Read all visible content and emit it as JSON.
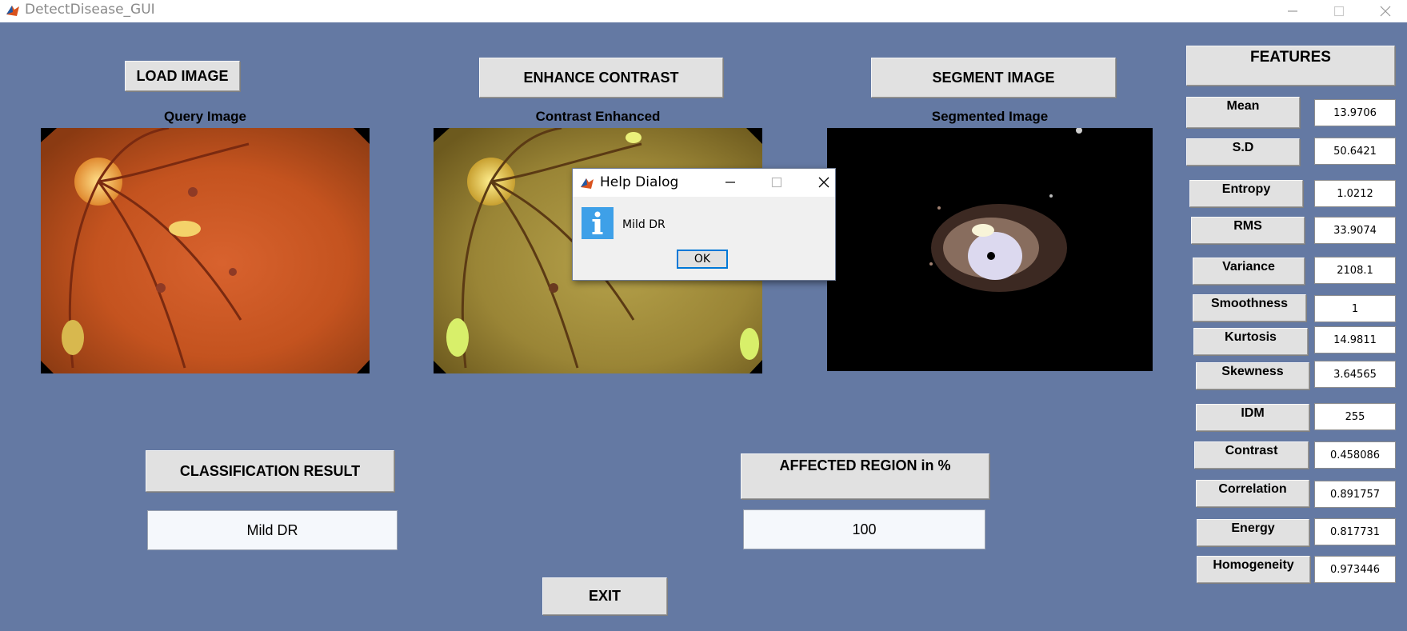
{
  "window": {
    "title": "DetectDisease_GUI"
  },
  "buttons": {
    "load": "LOAD IMAGE",
    "enhance": "ENHANCE CONTRAST",
    "segment": "SEGMENT IMAGE",
    "classification": "CLASSIFICATION RESULT",
    "affected": "AFFECTED REGION in %",
    "exit": "EXIT"
  },
  "panels": {
    "query": "Query Image",
    "enhanced": "Contrast Enhanced",
    "segmented": "Segmented Image"
  },
  "results": {
    "classification": "Mild DR",
    "affected_percent": "100"
  },
  "features": {
    "title": "FEATURES",
    "items": [
      {
        "label": "Mean",
        "value": "13.9706"
      },
      {
        "label": "S.D",
        "value": "50.6421"
      },
      {
        "label": "Entropy",
        "value": "1.0212"
      },
      {
        "label": "RMS",
        "value": "33.9074"
      },
      {
        "label": "Variance",
        "value": "2108.1"
      },
      {
        "label": "Smoothness",
        "value": "1"
      },
      {
        "label": "Kurtosis",
        "value": "14.9811"
      },
      {
        "label": "Skewness",
        "value": "3.64565"
      },
      {
        "label": "IDM",
        "value": "255"
      },
      {
        "label": "Contrast",
        "value": "0.458086"
      },
      {
        "label": "Correlation",
        "value": "0.891757"
      },
      {
        "label": "Energy",
        "value": "0.817731"
      },
      {
        "label": "Homogeneity",
        "value": "0.973446"
      }
    ]
  },
  "dialog": {
    "title": "Help Dialog",
    "message": "Mild DR",
    "ok": "OK"
  },
  "colors": {
    "background": "#6479a3",
    "button": "#e1e1e1",
    "info_icon": "#3ea0e8"
  }
}
